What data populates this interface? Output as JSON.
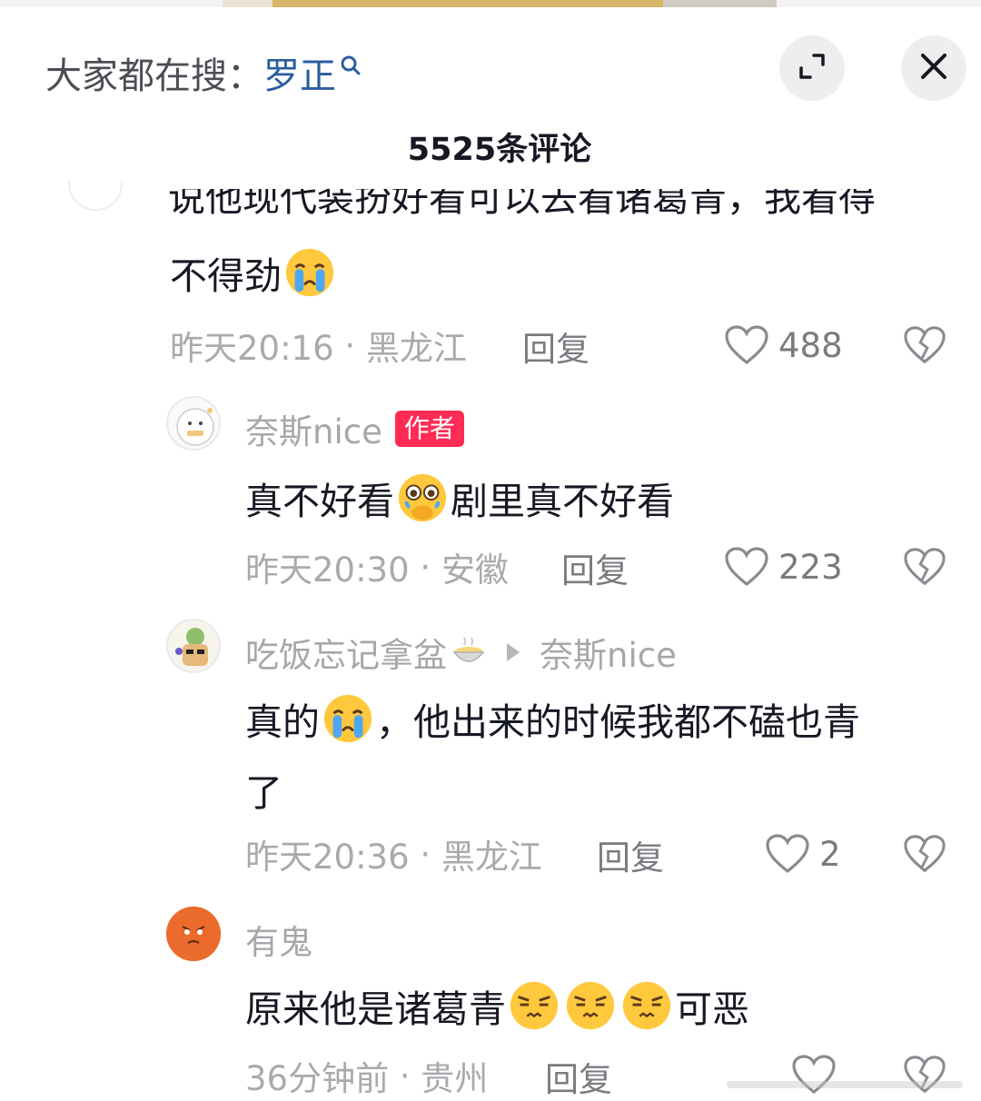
{
  "header": {
    "search_label": "大家都在搜：",
    "search_keyword": "罗正",
    "comment_count": "5525条评论"
  },
  "comments": [
    {
      "partial_text": "说他现代装扮好看可以去看诸葛青，我看得",
      "text": "不得劲",
      "emoji": "crying-emoji",
      "time": "昨天20:16",
      "location": "黑龙江",
      "reply_label": "回复",
      "likes": "488"
    },
    {
      "username": "奈斯nice",
      "badge": "作者",
      "text_a": "真不好看",
      "emoji": "holding-back-tears-emoji",
      "text_b": "剧里真不好看",
      "time": "昨天20:30",
      "location": "安徽",
      "reply_label": "回复",
      "likes": "223"
    },
    {
      "username": "吃饭忘记拿盆",
      "username_emoji": "bowl-emoji",
      "reply_to": "奈斯nice",
      "text_a": "真的",
      "emoji": "crying-emoji",
      "text_b": "，他出来的时候我都不磕也青",
      "text_c": "了",
      "time": "昨天20:36",
      "location": "黑龙江",
      "reply_label": "回复",
      "likes": "2"
    },
    {
      "username": "有鬼",
      "text_a": "原来他是诸葛青",
      "emojis": [
        "annoyed-emoji",
        "annoyed-emoji",
        "annoyed-emoji"
      ],
      "text_b": "可恶",
      "time": "36分钟前",
      "location": "贵州",
      "reply_label": "回复"
    }
  ],
  "colors": {
    "keyword": "#2a5d9f",
    "badge": "#fe2c55",
    "meta": "#a9aaae"
  }
}
